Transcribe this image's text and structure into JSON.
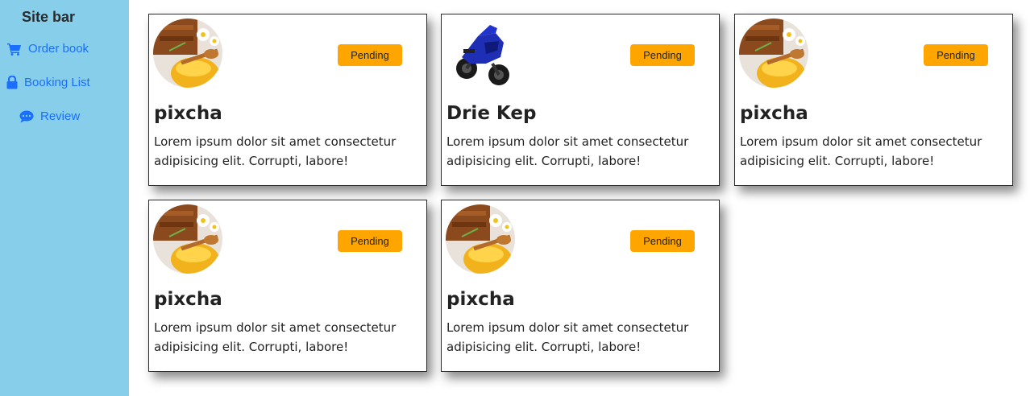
{
  "sidebar": {
    "title": "Site bar",
    "items": [
      {
        "label": "Order book",
        "icon": "cart-icon"
      },
      {
        "label": "Booking List",
        "icon": "lock-icon"
      },
      {
        "label": "Review",
        "icon": "comment-icon"
      }
    ]
  },
  "cards": [
    {
      "title": "pixcha",
      "status": "Pending",
      "image": "honey-image",
      "description": "Lorem ipsum dolor sit amet consectetur adipisicing elit. Corrupti, labore!"
    },
    {
      "title": "Drie Kep",
      "status": "Pending",
      "image": "motorcycle-image",
      "description": "Lorem ipsum dolor sit amet consectetur adipisicing elit. Corrupti, labore!"
    },
    {
      "title": "pixcha",
      "status": "Pending",
      "image": "honey-image",
      "description": "Lorem ipsum dolor sit amet consectetur adipisicing elit. Corrupti, labore!"
    },
    {
      "title": "pixcha",
      "status": "Pending",
      "image": "honey-image",
      "description": "Lorem ipsum dolor sit amet consectetur adipisicing elit. Corrupti, labore!"
    },
    {
      "title": "pixcha",
      "status": "Pending",
      "image": "honey-image",
      "description": "Lorem ipsum dolor sit amet consectetur adipisicing elit. Corrupti, labore!"
    }
  ],
  "colors": {
    "sidebar_bg": "#87ceeb",
    "nav_link": "#1a6fff",
    "badge_bg": "#ffa500"
  }
}
